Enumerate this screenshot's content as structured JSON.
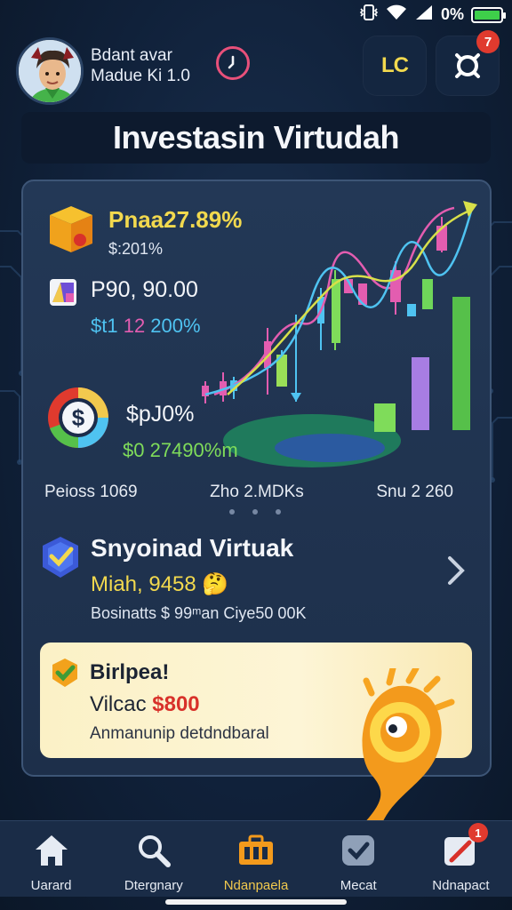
{
  "status_bar": {
    "battery_text": "0%"
  },
  "header": {
    "user_name": "Bdant avar",
    "user_sub": "Madue Ki 1.0",
    "lc_label": "LC",
    "notification_count": "7"
  },
  "title": "Investasin Virtudah",
  "card": {
    "item1": {
      "headline": "Pnaa27.89%",
      "sub": "$:201%"
    },
    "item2": {
      "value": "P90, 90.00",
      "sub_prefix": "$t1 ",
      "sub_pink": "12",
      "sub_suffix": " 200%"
    },
    "item3": {
      "value": "$pJ0%",
      "sub": "$0 27490%m"
    },
    "stats": [
      "Peioss 1069",
      "Zho 2.MDKs",
      "Snu 2 260"
    ]
  },
  "section": {
    "title": "Snyoinad Virtuak",
    "sub": "Miah, 9458 🤔",
    "detail": "Bosinatts $ 99ᵐan Ciye50 00K"
  },
  "promo": {
    "title": "Birlpea!",
    "line_prefix": "Vilcac ",
    "line_amount": "$800",
    "detail": "Anmanunip detdndbaral"
  },
  "nav": {
    "items": [
      {
        "label": "Uarard",
        "icon": "home-icon"
      },
      {
        "label": "Dtergnary",
        "icon": "search-icon"
      },
      {
        "label": "Ndanpaela",
        "icon": "briefcase-icon",
        "active": true
      },
      {
        "label": "Mecat",
        "icon": "check-badge-icon"
      },
      {
        "label": "Ndnapact",
        "icon": "pen-note-icon",
        "badge": "1"
      }
    ]
  },
  "colors": {
    "accent_yellow": "#f2d94e",
    "accent_cyan": "#4fc3f1",
    "accent_pink": "#e35db0",
    "accent_green": "#7fdc5a",
    "alert_red": "#e03a2e",
    "background": "#10213a"
  }
}
